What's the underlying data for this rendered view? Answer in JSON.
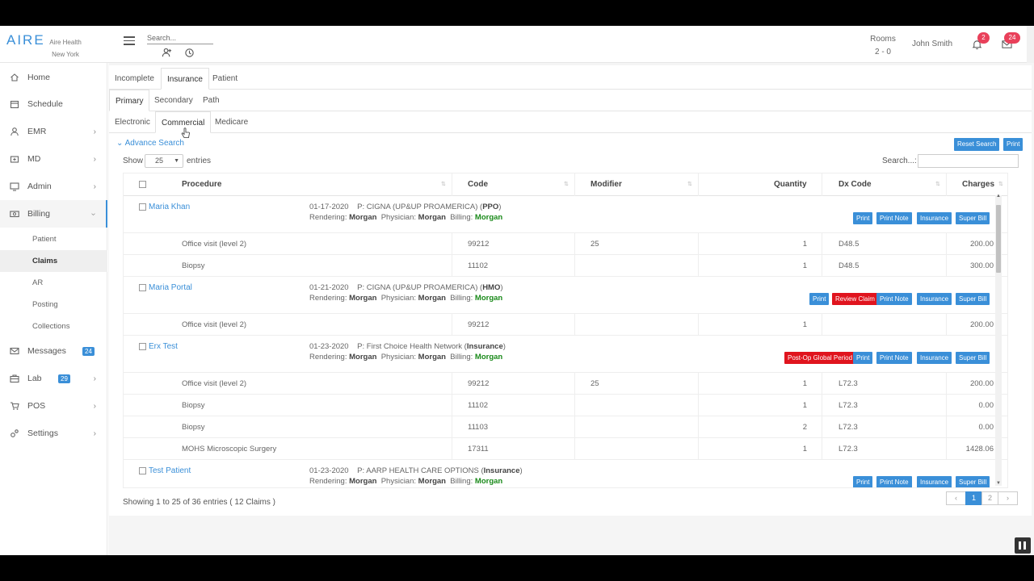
{
  "header": {
    "logo": "AIRE",
    "org_line1": "Aire Health",
    "org_line2": "New York",
    "search_placeholder": "Search...",
    "rooms_label": "Rooms",
    "rooms_value": "2 - 0",
    "user_name": "John Smith",
    "notifications_count": "2",
    "messages_count": "24"
  },
  "sidebar": {
    "items": [
      {
        "label": "Home"
      },
      {
        "label": "Schedule"
      },
      {
        "label": "EMR"
      },
      {
        "label": "MD"
      },
      {
        "label": "Admin"
      },
      {
        "label": "Billing"
      }
    ],
    "billing_sub": [
      "Patient",
      "Claims",
      "AR",
      "Posting",
      "Collections"
    ],
    "bottom_items": [
      {
        "label": "Messages",
        "badge": "24"
      },
      {
        "label": "Lab",
        "badge": "29"
      },
      {
        "label": "POS"
      },
      {
        "label": "Settings"
      }
    ]
  },
  "tabs": {
    "level1": [
      "Incomplete",
      "Insurance",
      "Patient"
    ],
    "level2": [
      "Primary",
      "Secondary",
      "Path"
    ],
    "level3": [
      "Electronic",
      "Commercial",
      "Medicare"
    ]
  },
  "toolbar": {
    "advance_search": "Advance Search",
    "reset_search": "Reset Search",
    "print": "Print",
    "show": "Show",
    "page_size": "25",
    "entries": "entries",
    "search_label": "Search...:"
  },
  "table": {
    "headers": [
      "Procedure",
      "Code",
      "Modifier",
      "Quantity",
      "Dx Code",
      "Charges"
    ],
    "groups": [
      {
        "patient": "Maria Khan",
        "date": "01-17-2020",
        "payer": "P: CIGNA (UP&UP PROAMERICA) (",
        "plan": "PPO",
        "rendering": "Morgan",
        "physician": "Morgan",
        "billing": "Morgan",
        "buttons": [
          "Print",
          "Print Note",
          "Insurance",
          "Super Bill"
        ],
        "rows": [
          {
            "procedure": "Office visit (level 2)",
            "code": "99212",
            "modifier": "25",
            "quantity": "1",
            "dx": "D48.5",
            "charges": "200.00"
          },
          {
            "procedure": "Biopsy",
            "code": "11102",
            "modifier": "",
            "quantity": "1",
            "dx": "D48.5",
            "charges": "300.00"
          }
        ]
      },
      {
        "patient": "Maria Portal",
        "date": "01-21-2020",
        "payer": "P: CIGNA (UP&UP PROAMERICA) (",
        "plan": "HMO",
        "rendering": "Morgan",
        "physician": "Morgan",
        "billing": "Morgan",
        "buttons": [
          "Print",
          "Review Claim",
          "Print Note",
          "Insurance",
          "Super Bill"
        ],
        "rows": [
          {
            "procedure": "Office visit (level 2)",
            "code": "99212",
            "modifier": "",
            "quantity": "1",
            "dx": "",
            "charges": "200.00"
          }
        ]
      },
      {
        "patient": "Erx Test",
        "date": "01-23-2020",
        "payer": "P: First Choice Health Network (",
        "plan": "Insurance",
        "rendering": "Morgan",
        "physician": "Morgan",
        "billing": "Morgan",
        "buttons": [
          "Post-Op Global Period",
          "Print",
          "Print Note",
          "Insurance",
          "Super Bill"
        ],
        "rows": [
          {
            "procedure": "Office visit (level 2)",
            "code": "99212",
            "modifier": "25",
            "quantity": "1",
            "dx": "L72.3",
            "charges": "200.00"
          },
          {
            "procedure": "Biopsy",
            "code": "11102",
            "modifier": "",
            "quantity": "1",
            "dx": "L72.3",
            "charges": "0.00"
          },
          {
            "procedure": "Biopsy",
            "code": "11103",
            "modifier": "",
            "quantity": "2",
            "dx": "L72.3",
            "charges": "0.00"
          },
          {
            "procedure": "MOHS Microscopic Surgery",
            "code": "17311",
            "modifier": "",
            "quantity": "1",
            "dx": "L72.3",
            "charges": "1428.06"
          }
        ]
      },
      {
        "patient": "Test Patient",
        "date": "01-23-2020",
        "payer": "P: AARP HEALTH CARE OPTIONS (",
        "plan": "Insurance",
        "rendering": "Morgan",
        "physician": "Morgan",
        "billing": "Morgan",
        "buttons": [
          "Print",
          "Print Note",
          "Insurance",
          "Super Bill"
        ],
        "rows": []
      }
    ],
    "labels": {
      "rendering": "Rendering:",
      "physician": "Physician:",
      "billing": "Billing:"
    }
  },
  "footer": {
    "showing": "Showing 1 to 25 of 36 entries ( 12 Claims )",
    "pages": [
      "1",
      "2"
    ]
  }
}
